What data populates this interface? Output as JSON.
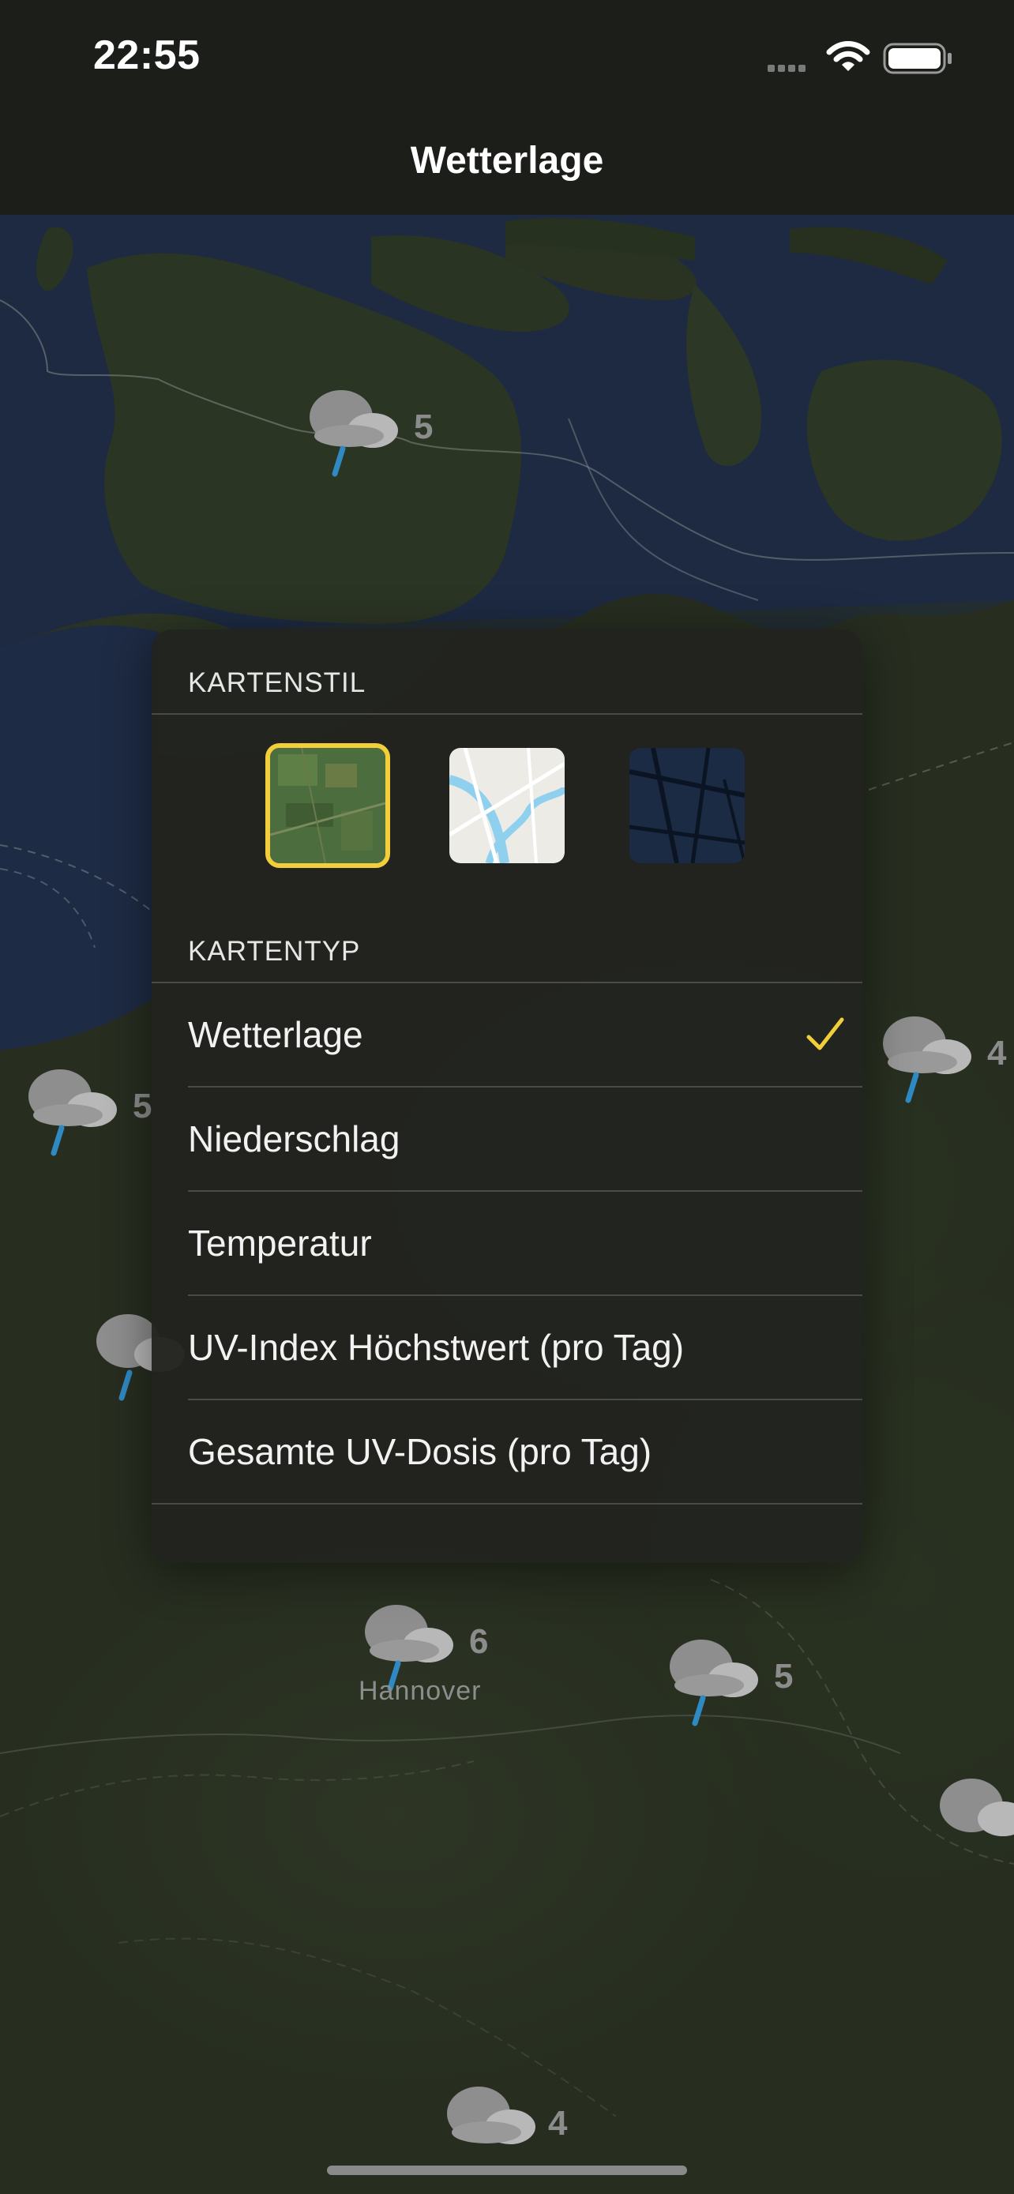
{
  "status_bar": {
    "time": "22:55"
  },
  "nav": {
    "title": "Wetterlage"
  },
  "map_markers": [
    {
      "name": "marker-north",
      "value": "5",
      "city": ""
    },
    {
      "name": "marker-east",
      "value": "4",
      "city": ""
    },
    {
      "name": "marker-west",
      "value": "5",
      "city": ""
    },
    {
      "name": "marker-hannover",
      "value": "6",
      "city": "Hannover"
    },
    {
      "name": "marker-southeast",
      "value": "5",
      "city": ""
    },
    {
      "name": "marker-bottom",
      "value": "4",
      "city": ""
    }
  ],
  "panel": {
    "map_style_header": "KARTENSTIL",
    "map_styles": [
      {
        "name": "satellite",
        "selected": true
      },
      {
        "name": "standard",
        "selected": false
      },
      {
        "name": "dark",
        "selected": false
      }
    ],
    "map_type_header": "KARTENTYP",
    "map_types": [
      {
        "label": "Wetterlage",
        "selected": true
      },
      {
        "label": "Niederschlag",
        "selected": false
      },
      {
        "label": "Temperatur",
        "selected": false
      },
      {
        "label": "UV-Index Höchstwert (pro Tag)",
        "selected": false
      },
      {
        "label": "Gesamte UV-Dosis (pro Tag)",
        "selected": false
      }
    ]
  },
  "colors": {
    "accent_yellow": "#f2cf3a",
    "panel_bg": "#22231f",
    "rain_blue": "#2f8ac4"
  }
}
